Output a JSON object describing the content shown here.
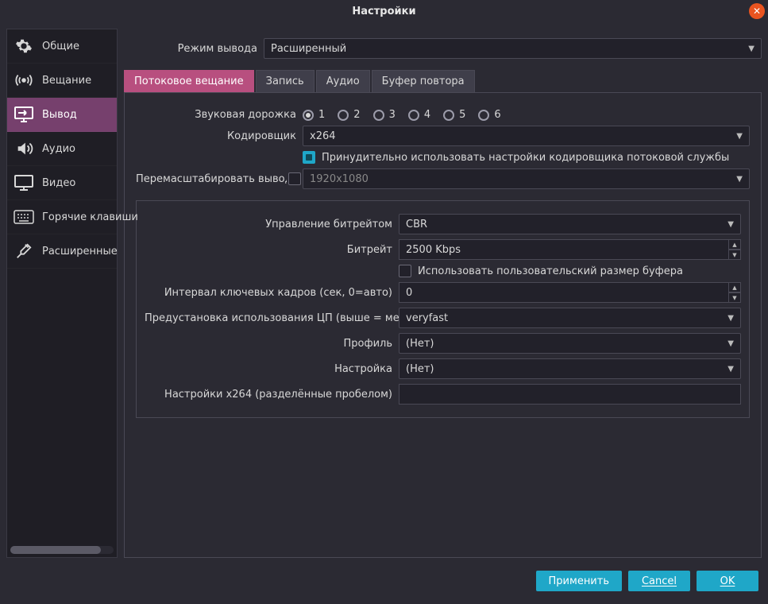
{
  "window": {
    "title": "Настройки"
  },
  "sidebar": {
    "items": [
      {
        "label": "Общие"
      },
      {
        "label": "Вещание"
      },
      {
        "label": "Вывод"
      },
      {
        "label": "Аудио"
      },
      {
        "label": "Видео"
      },
      {
        "label": "Горячие клавиши"
      },
      {
        "label": "Расширенные"
      }
    ]
  },
  "output_mode": {
    "label": "Режим вывода",
    "value": "Расширенный"
  },
  "tabs": [
    {
      "label": "Потоковое вещание"
    },
    {
      "label": "Запись"
    },
    {
      "label": "Аудио"
    },
    {
      "label": "Буфер повтора"
    }
  ],
  "audio_track": {
    "label": "Звуковая дорожка",
    "options": [
      "1",
      "2",
      "3",
      "4",
      "5",
      "6"
    ],
    "selected": "1"
  },
  "encoder": {
    "label": "Кодировщик",
    "value": "x264",
    "enforce_label": "Принудительно использовать настройки кодировщика потоковой службы",
    "enforce_checked": true
  },
  "rescale": {
    "label": "Перемасштабировать вывод",
    "checked": false,
    "value": "1920x1080"
  },
  "rate_control": {
    "label": "Управление битрейтом",
    "value": "CBR"
  },
  "bitrate": {
    "label": "Битрейт",
    "value": "2500 Kbps"
  },
  "custom_buffer": {
    "label": "Использовать пользовательский размер буфера",
    "checked": false
  },
  "keyframe": {
    "label": "Интервал ключевых кадров (сек, 0=авто)",
    "value": "0"
  },
  "cpu_preset": {
    "label": "Предустановка использования ЦП (выше = меньше)",
    "value": "veryfast"
  },
  "profile": {
    "label": "Профиль",
    "value": "(Нет)"
  },
  "tune": {
    "label": "Настройка",
    "value": "(Нет)"
  },
  "x264opts": {
    "label": "Настройки x264 (разделённые пробелом)",
    "value": ""
  },
  "footer": {
    "apply": "Применить",
    "cancel": "Cancel",
    "ok": "OK"
  }
}
